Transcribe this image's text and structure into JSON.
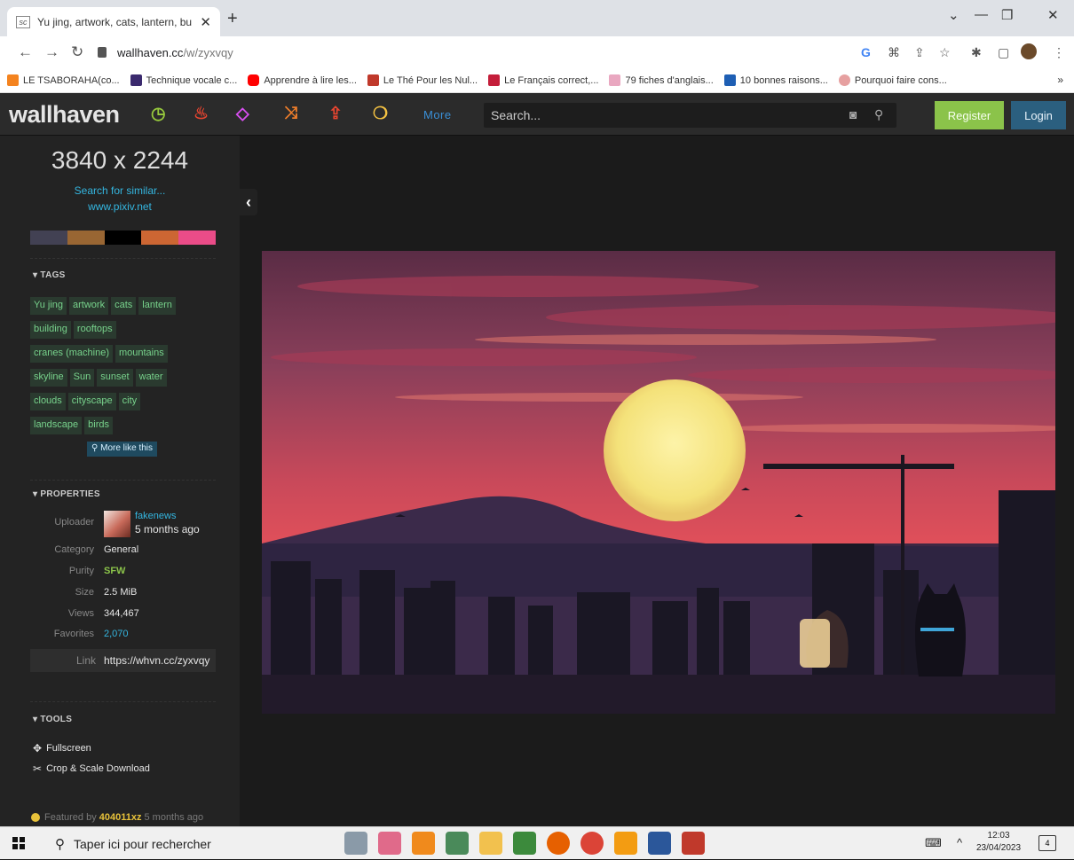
{
  "browser": {
    "tab_title": "Yu jing, artwork, cats, lantern, bu",
    "url_host": "wallhaven.cc",
    "url_path": "/w/zyxvqy",
    "bookmarks": [
      {
        "label": "LE TSABORAHA(co...",
        "color": "#f4831f"
      },
      {
        "label": "Technique vocale c...",
        "color": "#3b2a6e"
      },
      {
        "label": "Apprendre à lire les...",
        "color": "#ff0000"
      },
      {
        "label": "Le Thé Pour les Nul...",
        "color": "#c0392b"
      },
      {
        "label": "Le Français correct,...",
        "color": "#c41e3a"
      },
      {
        "label": "79 fiches d'anglais...",
        "color": "#e9a7c0"
      },
      {
        "label": "10 bonnes raisons...",
        "color": "#1e5fb4"
      },
      {
        "label": "Pourquoi faire cons...",
        "color": "#e6a0a0"
      }
    ]
  },
  "site": {
    "logo": "wallhaven",
    "more_label": "More",
    "search_placeholder": "Search...",
    "register_label": "Register",
    "login_label": "Login",
    "nav_icon_colors": [
      "#97c93d",
      "#e84530",
      "#d94ff2",
      "#ef7e2b",
      "#e84530",
      "#f4c242"
    ]
  },
  "wallpaper": {
    "resolution": "3840 x 2244",
    "search_similar": "Search for similar...",
    "source": "www.pixiv.net",
    "palette": [
      "#424153",
      "#996633",
      "#000000",
      "#cc6633",
      "#ea4c88"
    ]
  },
  "tags": {
    "heading": "TAGS",
    "rows": [
      [
        "Yu jing",
        "artwork",
        "cats",
        "lantern"
      ],
      [
        "building",
        "rooftops"
      ],
      [
        "cranes (machine)",
        "mountains"
      ],
      [
        "skyline",
        "Sun",
        "sunset",
        "water"
      ],
      [
        "clouds",
        "cityscape",
        "city"
      ],
      [
        "landscape",
        "birds"
      ]
    ],
    "more_like_this": "More like this"
  },
  "properties": {
    "heading": "PROPERTIES",
    "uploader_label": "Uploader",
    "uploader_name": "fakenews",
    "uploader_ago": "5 months ago",
    "category_label": "Category",
    "category": "General",
    "purity_label": "Purity",
    "purity": "SFW",
    "size_label": "Size",
    "size": "2.5 MiB",
    "views_label": "Views",
    "views": "344,467",
    "favorites_label": "Favorites",
    "favorites": "2,070",
    "link_label": "Link",
    "link": "https://whvn.cc/zyxvqy"
  },
  "tools": {
    "heading": "TOOLS",
    "fullscreen": "Fullscreen",
    "crop": "Crop & Scale Download"
  },
  "featured": {
    "prefix": "Featured by",
    "user": "404011xz",
    "ago": "5 months ago"
  },
  "taskbar": {
    "search_placeholder": "Taper ici pour rechercher",
    "time": "12:03",
    "date": "23/04/2023",
    "notifications": "4"
  }
}
